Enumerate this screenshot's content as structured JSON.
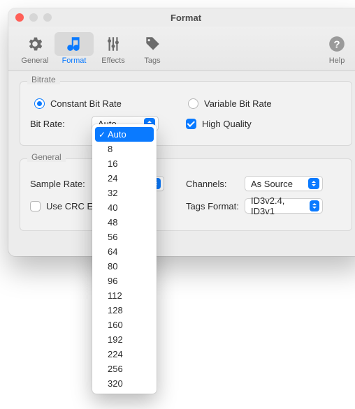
{
  "window": {
    "title": "Format"
  },
  "toolbar": {
    "items": [
      {
        "name": "general",
        "label": "General"
      },
      {
        "name": "format",
        "label": "Format"
      },
      {
        "name": "effects",
        "label": "Effects"
      },
      {
        "name": "tags",
        "label": "Tags"
      }
    ],
    "help": {
      "label": "Help"
    },
    "active": "format"
  },
  "bitrate": {
    "legend": "Bitrate",
    "mode_constant": "Constant Bit Rate",
    "mode_variable": "Variable Bit Rate",
    "mode_selected": "constant",
    "rate_label": "Bit Rate:",
    "rate_value": "Auto",
    "rate_options": [
      "Auto",
      "8",
      "16",
      "24",
      "32",
      "40",
      "48",
      "56",
      "64",
      "80",
      "96",
      "112",
      "128",
      "160",
      "192",
      "224",
      "256",
      "320"
    ],
    "high_quality_label": "High Quality",
    "high_quality": true
  },
  "general": {
    "legend": "General",
    "sample_rate_label": "Sample Rate:",
    "use_crc_label": "Use CRC Error Protection",
    "use_crc_label_visible": "Use CRC E",
    "use_crc": false,
    "channels_label": "Channels:",
    "channels_value": "As Source",
    "tags_format_label": "Tags Format:",
    "tags_format_value": "ID3v2.4, ID3v1"
  }
}
